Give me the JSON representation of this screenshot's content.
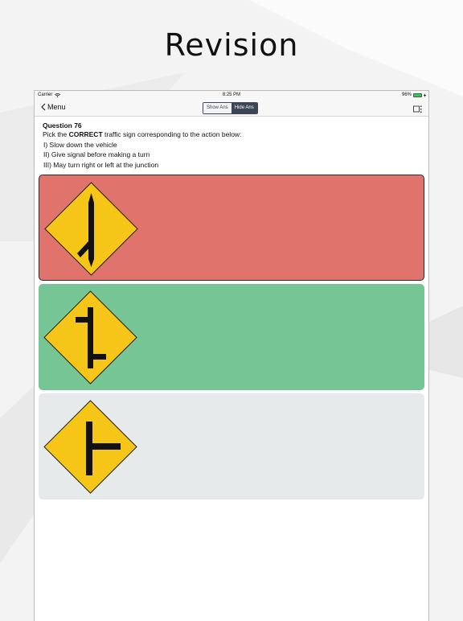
{
  "header": {
    "title": "Revision"
  },
  "status_bar": {
    "carrier": "Carrier",
    "time": "8:25 PM",
    "battery": "96%",
    "battery_level": 0.96
  },
  "nav": {
    "back_label": "Menu",
    "segments": [
      {
        "label": "Show Ans",
        "selected": false
      },
      {
        "label": "Hide Ans",
        "selected": true
      }
    ],
    "right_icon": "layout-icon"
  },
  "question": {
    "number": "Question 76",
    "prompt_prefix": "Pick the ",
    "prompt_bold": "CORRECT",
    "prompt_suffix": " traffic sign corresponding to the action below:",
    "lines": [
      "I)  Slow down the vehicle",
      "II)  Give signal before making a turn",
      "III) May turn right or left at the junction"
    ]
  },
  "options": [
    {
      "sign": "merge-from-left-sign-icon",
      "state": "incorrect",
      "color": "#e0736c"
    },
    {
      "sign": "staggered-junction-sign-icon",
      "state": "correct",
      "color": "#76c595"
    },
    {
      "sign": "t-junction-right-sign-icon",
      "state": "neutral",
      "color": "#e6eaea"
    }
  ],
  "colors": {
    "sign_yellow": "#f5c518",
    "segment_dark": "#3d4654"
  }
}
